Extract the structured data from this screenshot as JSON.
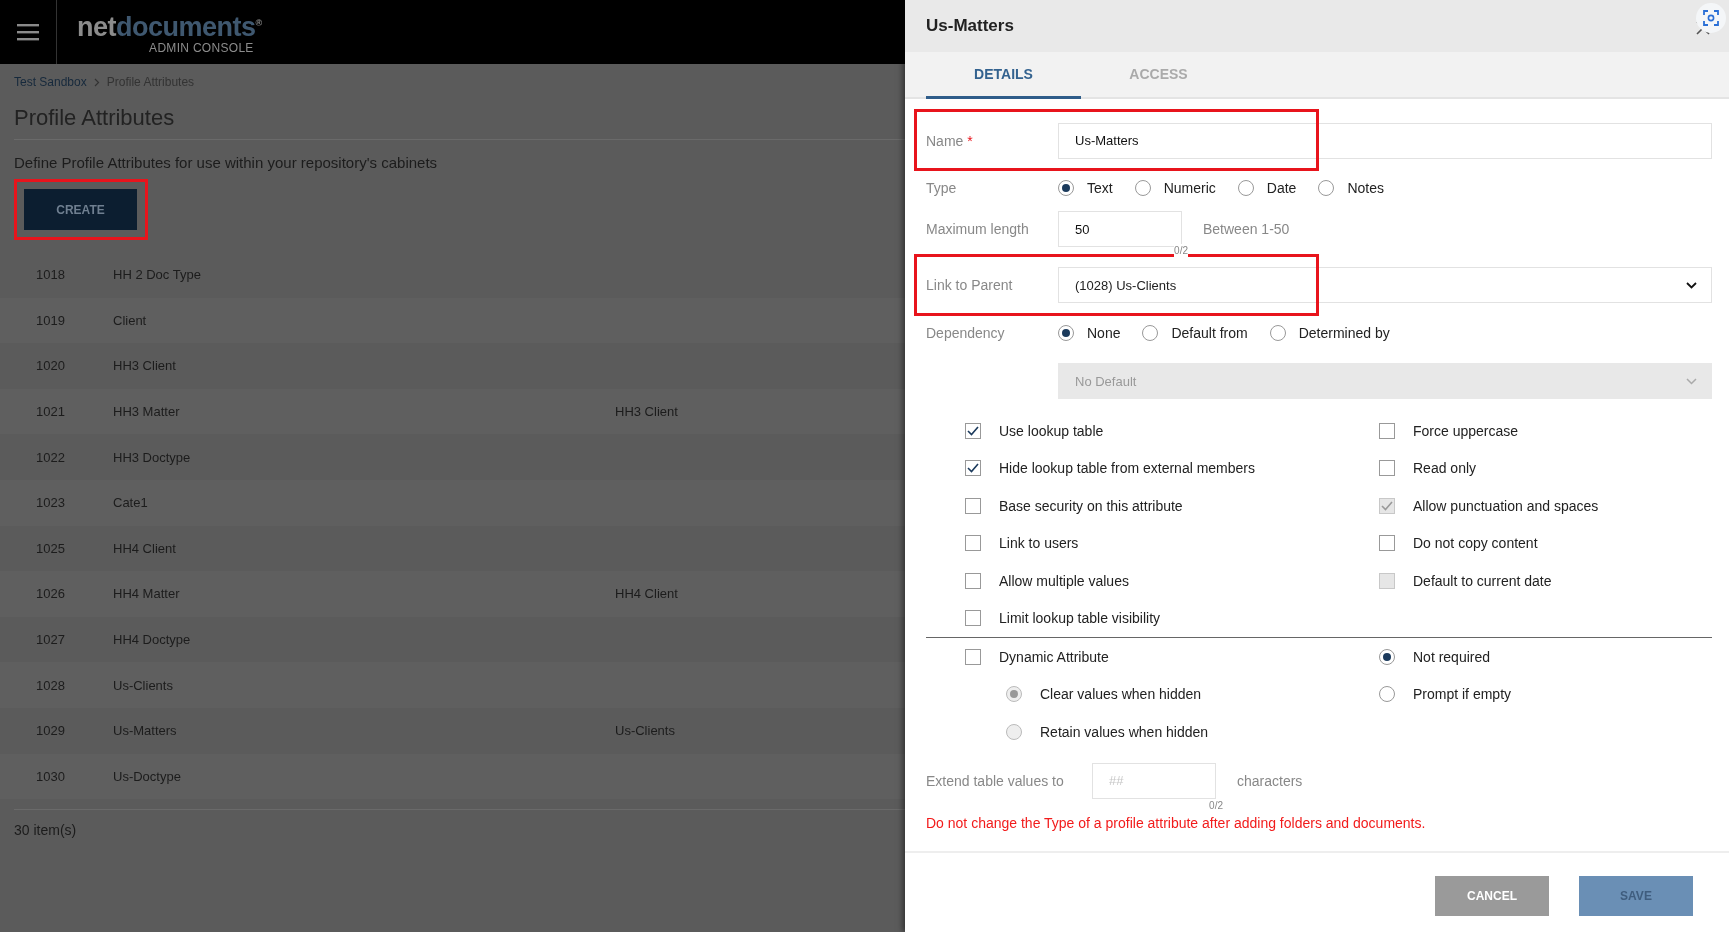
{
  "header": {
    "logo": {
      "prefix": "net",
      "suffix": "documents",
      "mark": "®",
      "subtitle": "ADMIN CONSOLE"
    }
  },
  "breadcrumb": [
    {
      "label": "Test Sandbox",
      "link": true
    },
    {
      "label": "Profile Attributes",
      "link": false
    }
  ],
  "page_title": "Profile Attributes",
  "description": "Define Profile Attributes for use within your repository's cabinets",
  "create_button": {
    "label": "CREATE",
    "highlighted": true
  },
  "table": {
    "rows": [
      {
        "id": "1018",
        "name": "HH 2 Doc Type",
        "parent": ""
      },
      {
        "id": "1019",
        "name": "Client",
        "parent": ""
      },
      {
        "id": "1020",
        "name": "HH3 Client",
        "parent": ""
      },
      {
        "id": "1021",
        "name": "HH3 Matter",
        "parent": "HH3 Client"
      },
      {
        "id": "1022",
        "name": "HH3 Doctype",
        "parent": ""
      },
      {
        "id": "1023",
        "name": "Cate1",
        "parent": ""
      },
      {
        "id": "1025",
        "name": "HH4 Client",
        "parent": ""
      },
      {
        "id": "1026",
        "name": "HH4 Matter",
        "parent": "HH4 Client"
      },
      {
        "id": "1027",
        "name": "HH4 Doctype",
        "parent": ""
      },
      {
        "id": "1028",
        "name": "Us-Clients",
        "parent": ""
      },
      {
        "id": "1029",
        "name": "Us-Matters",
        "parent": "Us-Clients"
      },
      {
        "id": "1030",
        "name": "Us-Doctype",
        "parent": ""
      }
    ]
  },
  "item_count": "30 item(s)",
  "panel": {
    "title": "Us-Matters",
    "tabs": [
      {
        "label": "DETAILS",
        "selected": true
      },
      {
        "label": "ACCESS",
        "selected": false
      }
    ],
    "name_field": {
      "label": "Name",
      "required_mark": "*",
      "value": "Us-Matters",
      "highlighted": true
    },
    "type": {
      "label": "Type",
      "options": [
        {
          "label": "Text",
          "selected": true
        },
        {
          "label": "Numeric",
          "selected": false
        },
        {
          "label": "Date",
          "selected": false
        },
        {
          "label": "Notes",
          "selected": false
        }
      ]
    },
    "max_length": {
      "label": "Maximum length",
      "value": "50",
      "hint": "Between 1-50",
      "counter": "0/2"
    },
    "link_to_parent": {
      "label": "Link to Parent",
      "value": "(1028) Us-Clients",
      "highlighted": true
    },
    "dependency": {
      "label": "Dependency",
      "options": [
        {
          "label": "None",
          "selected": true
        },
        {
          "label": "Default from",
          "selected": false
        },
        {
          "label": "Determined by",
          "selected": false
        }
      ]
    },
    "default_select": {
      "value": "No Default",
      "disabled": true
    },
    "checkboxes_left": [
      {
        "label": "Use lookup table",
        "checked": true,
        "disabled": false
      },
      {
        "label": "Hide lookup table from external members",
        "checked": true,
        "disabled": false
      },
      {
        "label": "Base security on this attribute",
        "checked": false,
        "disabled": false
      },
      {
        "label": "Link to users",
        "checked": false,
        "disabled": false
      },
      {
        "label": "Allow multiple values",
        "checked": false,
        "disabled": false
      },
      {
        "label": "Limit lookup table visibility",
        "checked": false,
        "disabled": false
      }
    ],
    "checkboxes_right": [
      {
        "label": "Force uppercase",
        "checked": false,
        "disabled": false
      },
      {
        "label": "Read only",
        "checked": false,
        "disabled": false
      },
      {
        "label": "Allow punctuation and spaces",
        "checked": true,
        "disabled": true
      },
      {
        "label": "Do not copy content",
        "checked": false,
        "disabled": false
      },
      {
        "label": "Default to current date",
        "checked": false,
        "disabled": true
      }
    ],
    "dynamic": {
      "label": "Dynamic Attribute",
      "checked": false
    },
    "hidden_options": [
      {
        "label": "Clear values when hidden",
        "selected": true,
        "disabled": true
      },
      {
        "label": "Retain values when hidden",
        "selected": false,
        "disabled": true
      }
    ],
    "required_options": [
      {
        "label": "Not required",
        "selected": true
      },
      {
        "label": "Prompt if empty",
        "selected": false
      }
    ],
    "extend": {
      "label": "Extend table values to",
      "placeholder": "##",
      "suffix": "characters",
      "counter": "0/2"
    },
    "warning": "Do not change the Type of a profile attribute after adding folders and documents.",
    "buttons": [
      {
        "label": "CANCEL",
        "kind": "cancel"
      },
      {
        "label": "SAVE",
        "kind": "save"
      }
    ]
  }
}
